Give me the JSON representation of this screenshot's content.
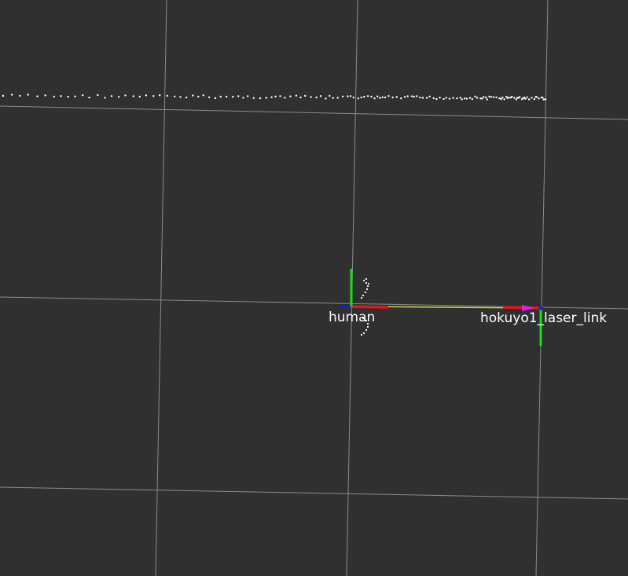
{
  "view": {
    "background_color": "#303030",
    "grid_color": "#a0a0a0",
    "laser_scan_color": "#ffffff"
  },
  "frames": [
    {
      "name": "human",
      "label": "human"
    },
    {
      "name": "hokuyo1_laser_link",
      "label": "hokuyo1_laser_link"
    }
  ],
  "axis_colors": {
    "x": "#e8141c",
    "y": "#16e016",
    "z": "#1020e0",
    "tf_link": "#d2d23c",
    "tf_arrow": "#e020e0"
  }
}
